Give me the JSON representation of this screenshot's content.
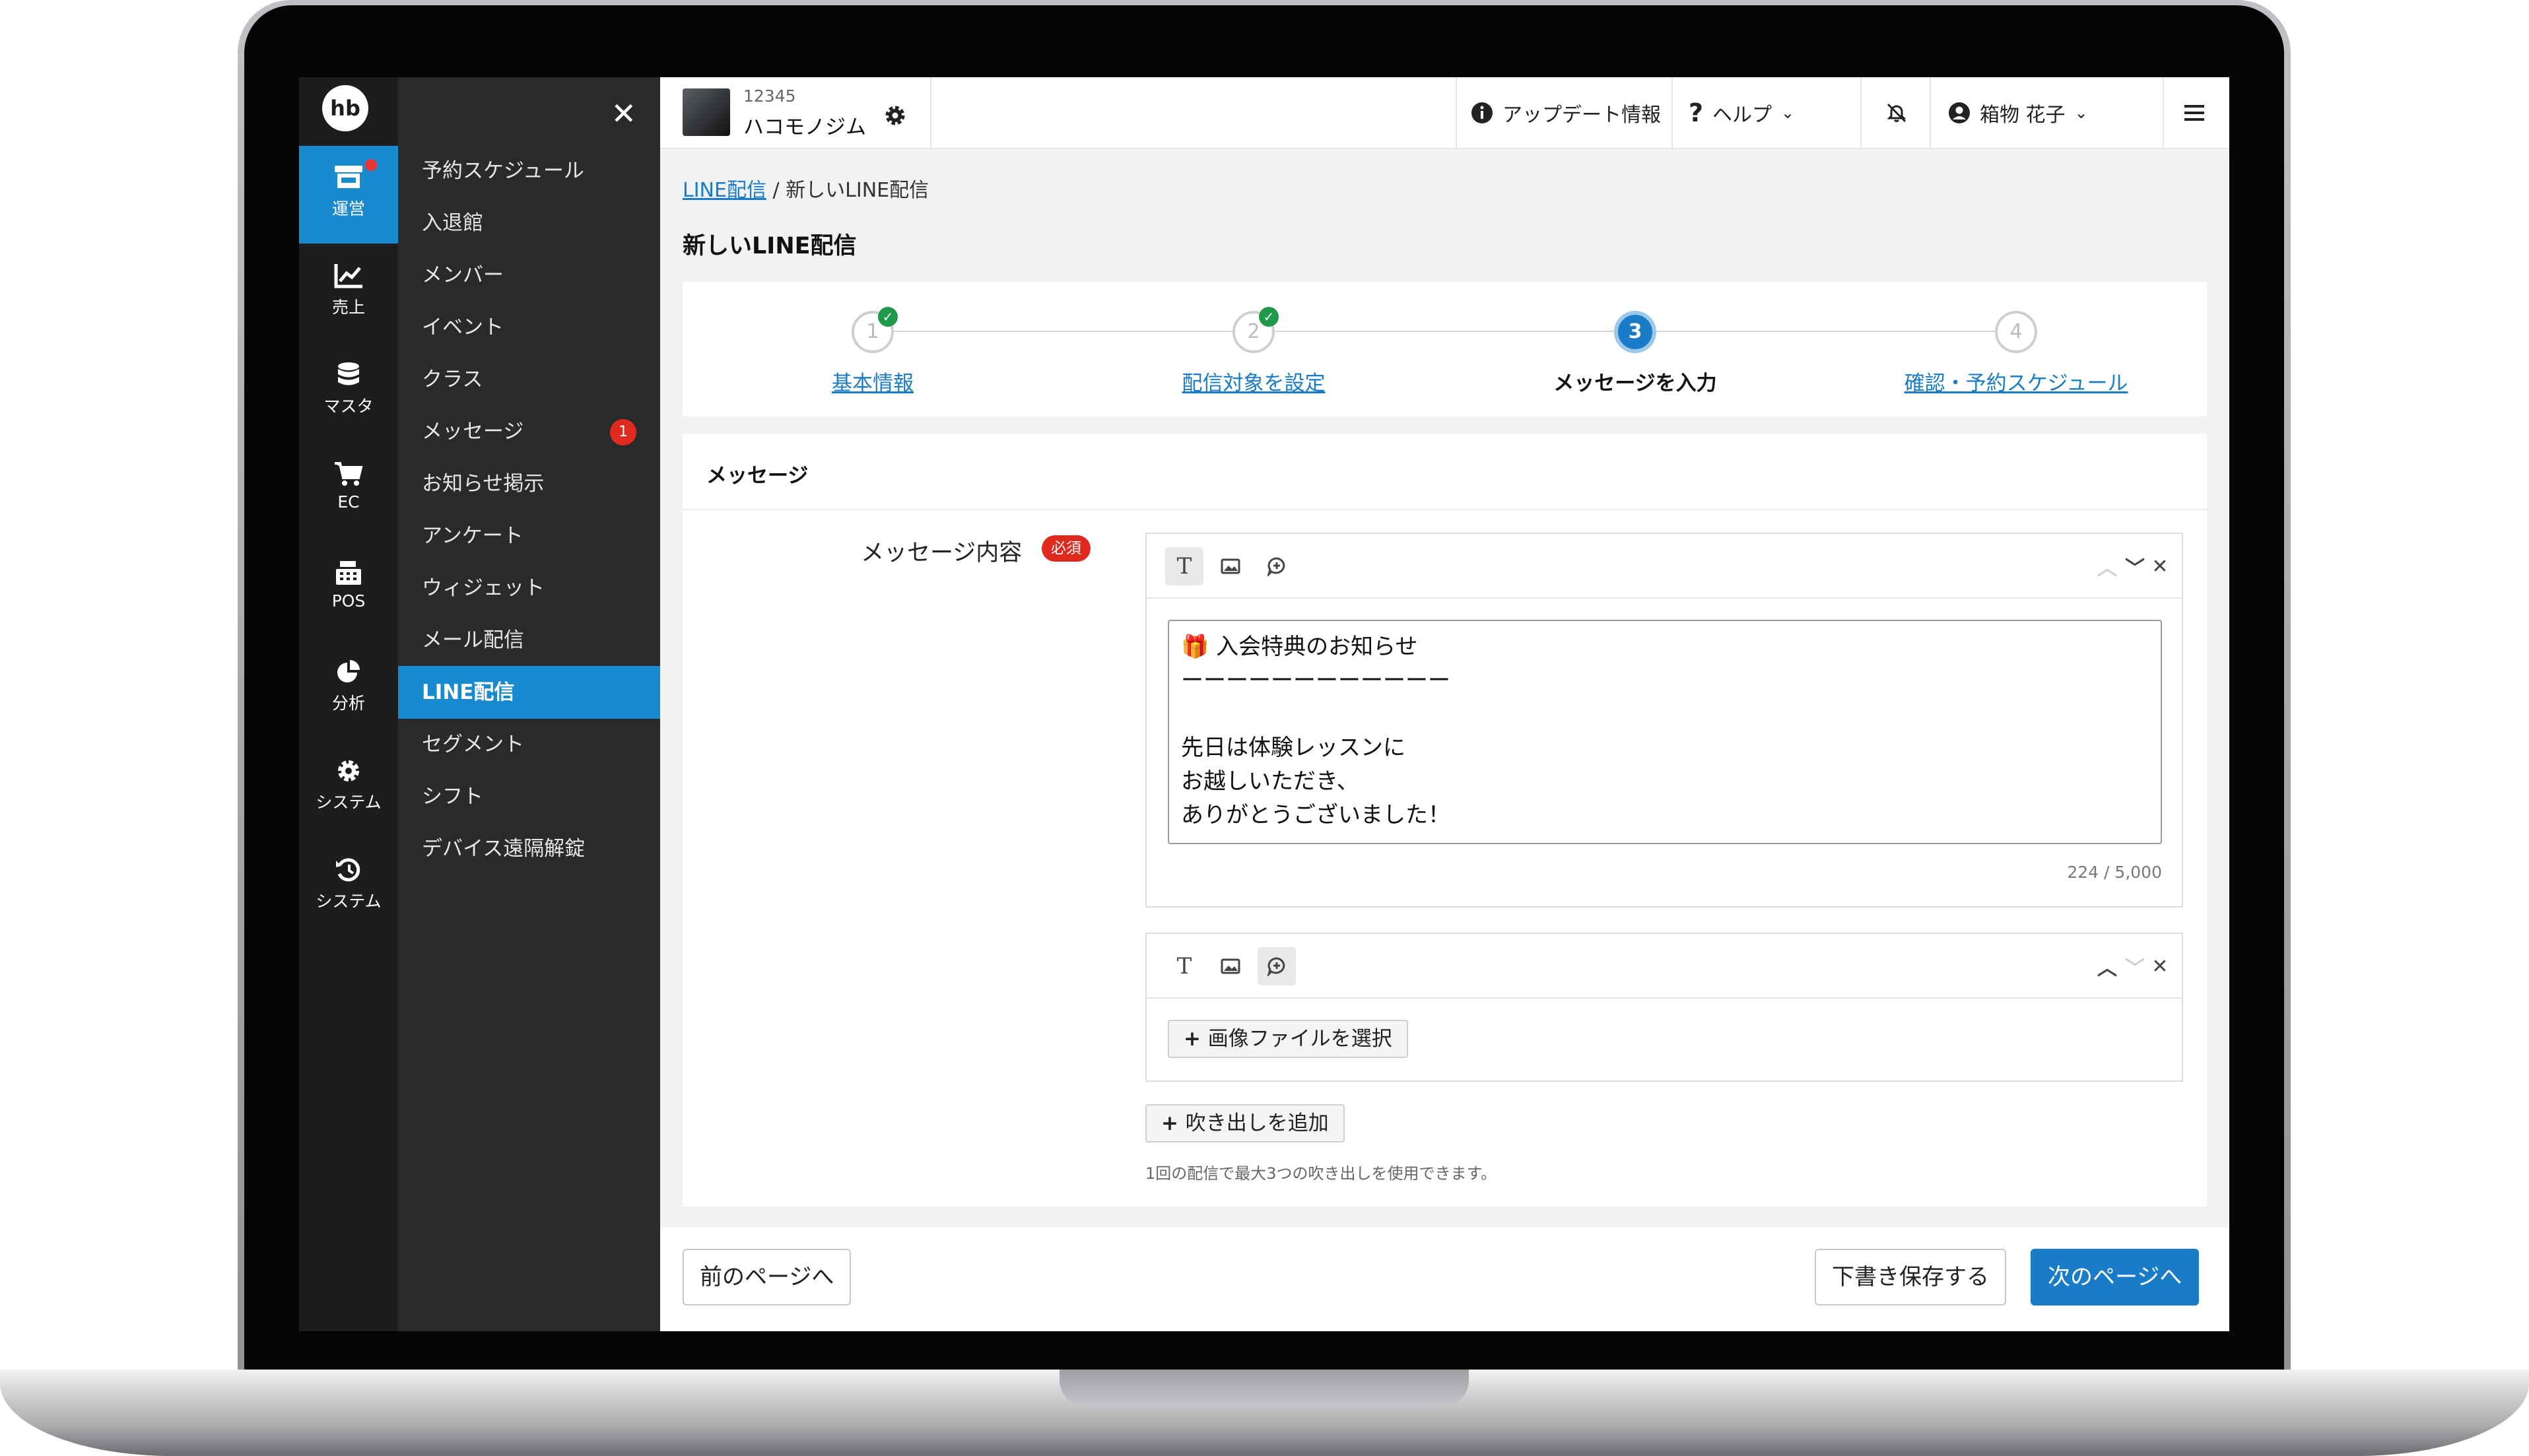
{
  "rail": {
    "logo": "hb",
    "items": [
      {
        "label": "運営",
        "icon": "store-icon",
        "active": true,
        "notify": true
      },
      {
        "label": "売上",
        "icon": "chart-line-icon"
      },
      {
        "label": "マスタ",
        "icon": "database-icon"
      },
      {
        "label": "EC",
        "icon": "cart-icon"
      },
      {
        "label": "POS",
        "icon": "cash-register-icon"
      },
      {
        "label": "分析",
        "icon": "pie-chart-icon"
      },
      {
        "label": "システム",
        "icon": "gear-icon"
      },
      {
        "label": "システム",
        "icon": "history-icon"
      }
    ]
  },
  "menu": {
    "close_icon": "close-icon",
    "items": [
      {
        "label": "予約スケジュール"
      },
      {
        "label": "入退館"
      },
      {
        "label": "メンバー"
      },
      {
        "label": "イベント"
      },
      {
        "label": "クラス"
      },
      {
        "label": "メッセージ",
        "badge": "1"
      },
      {
        "label": "お知らせ掲示"
      },
      {
        "label": "アンケート"
      },
      {
        "label": "ウィジェット"
      },
      {
        "label": "メール配信"
      },
      {
        "label": "LINE配信",
        "active": true
      },
      {
        "label": "セグメント"
      },
      {
        "label": "シフト"
      },
      {
        "label": "デバイス遠隔解錠"
      }
    ]
  },
  "header": {
    "gym_id": "12345",
    "gym_name": "ハコモノジム",
    "update_info": "アップデート情報",
    "help": "ヘルプ",
    "user_name": "箱物 花子"
  },
  "breadcrumb": {
    "parent": "LINE配信",
    "separator": " / ",
    "current": "新しいLINE配信"
  },
  "page_title": "新しいLINE配信",
  "steps": [
    {
      "num": "1",
      "label": "基本情報",
      "done": true
    },
    {
      "num": "2",
      "label": "配信対象を設定",
      "done": true
    },
    {
      "num": "3",
      "label": "メッセージを入力",
      "current": true
    },
    {
      "num": "4",
      "label": "確認・予約スケジュール"
    }
  ],
  "message_section": {
    "title": "メッセージ",
    "field_label": "メッセージ内容",
    "required_badge": "必須",
    "bubble1_text": "🎁 入会特典のお知らせ\nーーーーーーーーーーーー\n\n先日は体験レッスンに\nお越しいただき、\nありがとうございました！",
    "bubble1_counter": "224 / 5,000",
    "select_image_label": "画像ファイルを選択",
    "add_bubble_label": "吹き出しを追加",
    "note": "1回の配信で最大3つの吹き出しを使用できます。"
  },
  "footer": {
    "prev": "前のページへ",
    "save_draft": "下書き保存する",
    "next": "次のページへ"
  },
  "colors": {
    "accent": "#1a7cc6",
    "sidebar_active": "#1a8ad0",
    "badge": "#e02a1f",
    "done": "#1f9a4a"
  }
}
